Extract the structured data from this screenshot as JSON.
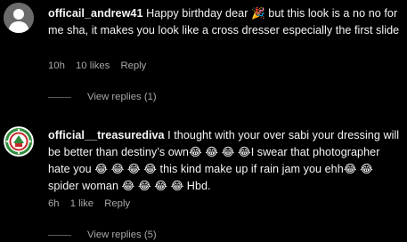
{
  "comments": [
    {
      "username": "officail_andrew41",
      "text": " Happy birthday dear 🎉 but this look is a no no for me sha, it makes you look like a cross dresser especially the first slide",
      "time": "10h",
      "likes": "10 likes",
      "reply_label": "Reply",
      "view_replies": "View replies (1)"
    },
    {
      "username": "official__treasurediva",
      "text": " I thought with your over sabi your dressing will be better than destiny’s own😂 😂 😂 😂I swear that photographer hate you 😂 😂 😂 😂 this kind make up if rain jam you ehh😂 😂 spider woman 😂 😂 😂 😂 Hbd.",
      "time": "6h",
      "likes": "1 like",
      "reply_label": "Reply",
      "view_replies": "View replies (5)"
    }
  ],
  "colors": {
    "background": "#000000",
    "text": "#f5f5f5",
    "muted": "#a8a8a8",
    "avatar_placeholder": "#6b6b6b",
    "badge_green": "#2e8b3a",
    "badge_red": "#c62828"
  }
}
